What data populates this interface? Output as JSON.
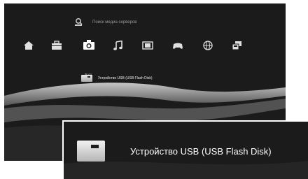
{
  "top_item": {
    "label": "Поиск медиа серверов",
    "icon": "media-server-search-icon"
  },
  "categories": [
    {
      "name": "home",
      "icon": "home-icon",
      "label": ""
    },
    {
      "name": "settings",
      "icon": "toolbox-icon",
      "label": ""
    },
    {
      "name": "photo",
      "icon": "camera-icon",
      "label": "Фото",
      "selected": true
    },
    {
      "name": "music",
      "icon": "music-note-icon",
      "label": ""
    },
    {
      "name": "video",
      "icon": "film-icon",
      "label": ""
    },
    {
      "name": "game",
      "icon": "gamepad-icon",
      "label": ""
    },
    {
      "name": "network",
      "icon": "globe-icon",
      "label": ""
    },
    {
      "name": "friends",
      "icon": "friends-icon",
      "label": ""
    }
  ],
  "selected_category_label": "Фото",
  "device": {
    "label": "Устройство USB (USB Flash Disk)",
    "icon": "usb-drive-icon"
  },
  "zoom": {
    "label": "Устройство USB (USB Flash Disk)"
  },
  "colors": {
    "background": "#1b1b1b",
    "text": "#ffffff",
    "muted": "#9a9a9a"
  }
}
